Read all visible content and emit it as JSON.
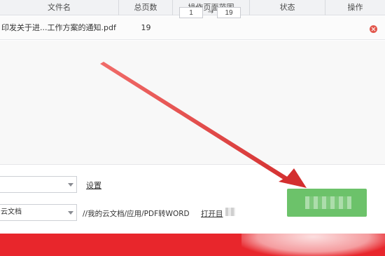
{
  "table": {
    "headers": [
      "文件名",
      "总页数",
      "操作页面范围",
      "状态",
      "操作"
    ],
    "rows": [
      {
        "filename": "印发关于进...工作方案的通知.pdf",
        "pages": "19",
        "range_from": "1",
        "range_to": "19"
      }
    ]
  },
  "settings": {
    "settings_link": "设置",
    "output_location": "云文档",
    "output_path": "//我的云文档/应用/PDF转WORD",
    "open_dir_link": "打开目"
  },
  "icons": {
    "delete": "delete-icon",
    "arrow": "red-annotation-arrow"
  },
  "colors": {
    "accent_red": "#e8262c",
    "start_green": "#6cc26a",
    "annotation_red": "#e53935"
  }
}
